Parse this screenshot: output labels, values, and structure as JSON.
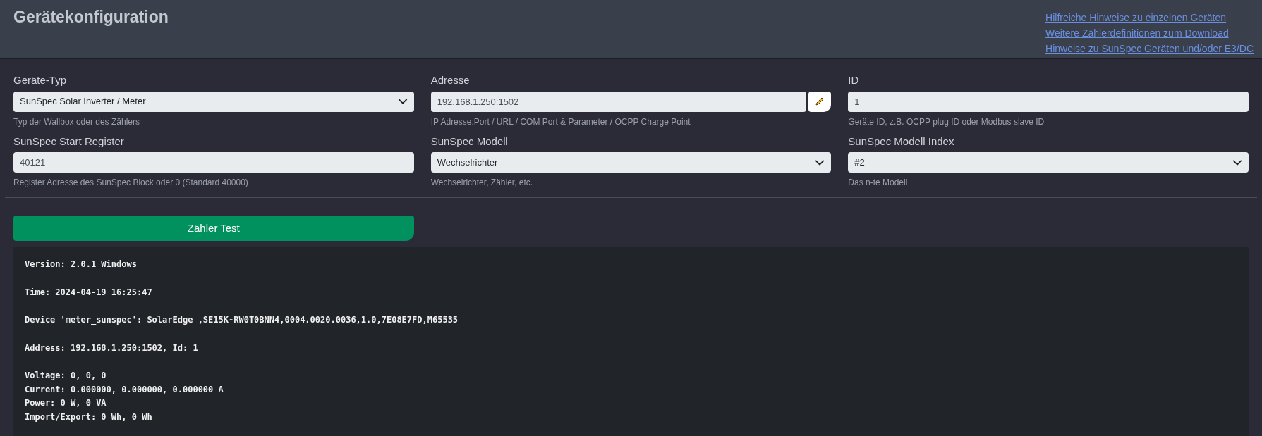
{
  "header": {
    "title": "Gerätekonfiguration",
    "links": [
      "Hilfreiche Hinweise zu einzelnen Geräten",
      "Weitere Zählerdefinitionen zum Download",
      "Hinweise zu SunSpec Geräten und/oder E3/DC"
    ]
  },
  "fields": [
    {
      "kind": "select",
      "label": "Geräte-Typ",
      "value": "SunSpec Solar Inverter / Meter",
      "help": "Typ der Wallbox oder des Zählers"
    },
    {
      "kind": "edit",
      "label": "Adresse",
      "value": "192.168.1.250:1502",
      "help": "IP Adresse:Port / URL / COM Port & Parameter / OCPP Charge Point"
    },
    {
      "kind": "text",
      "label": "ID",
      "value": "1",
      "help": "Geräte ID, z.B. OCPP plug ID oder Modbus slave ID"
    },
    {
      "kind": "text",
      "label": "SunSpec Start Register",
      "value": "40121",
      "help": "Register Adresse des SunSpec Block oder 0 (Standard 40000)"
    },
    {
      "kind": "select",
      "label": "SunSpec Modell",
      "value": "Wechselrichter",
      "help": "Wechselrichter, Zähler, etc."
    },
    {
      "kind": "select",
      "label": "SunSpec Modell Index",
      "value": "#2",
      "help": "Das n-te Modell"
    }
  ],
  "test_button": "Zähler Test",
  "output": [
    [
      "Version: 2.0.1 Windows"
    ],
    [
      "Time: 2024-04-19 16:25:47"
    ],
    [
      "Device 'meter_sunspec': SolarEdge ,SE15K-RW0T0BNN4,0004.0020.0036,1.0,7E08E7FD,M65535"
    ],
    [
      "Address: 192.168.1.250:1502, Id: 1"
    ],
    [
      "Voltage: 0, 0, 0",
      "Current: 0.000000, 0.000000, 0.000000 A",
      "Power: 0 W, 0 VA",
      "Import/Export: 0 Wh, 0 Wh"
    ]
  ]
}
